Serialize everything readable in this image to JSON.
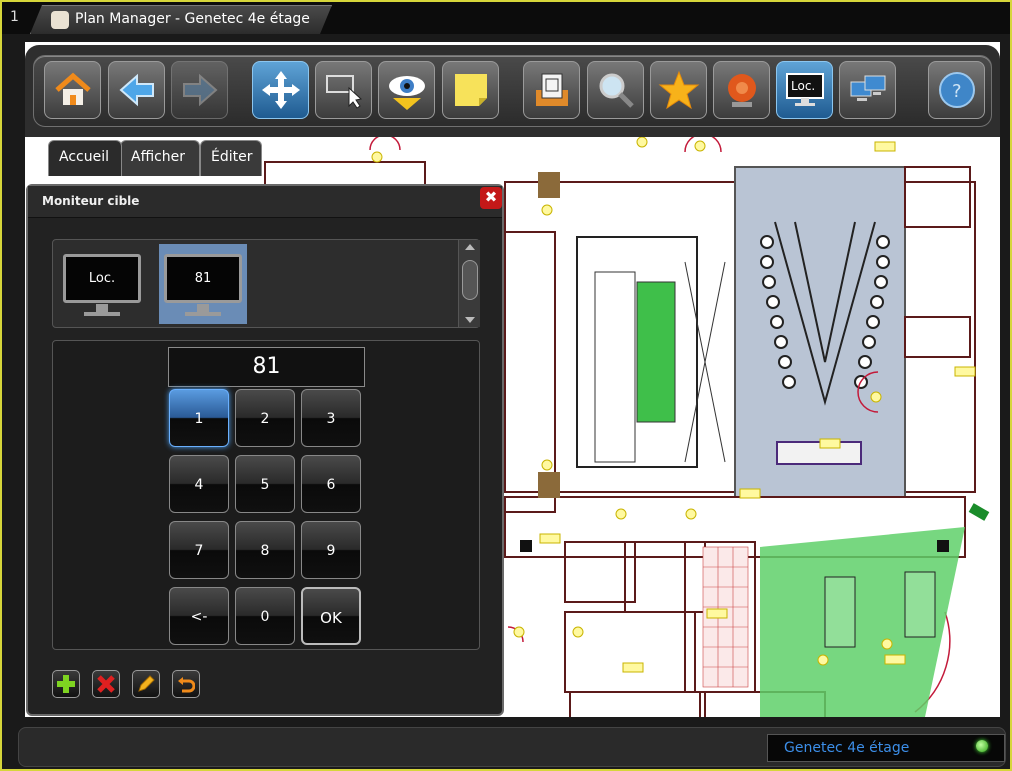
{
  "window": {
    "tab_number": "1",
    "title": "Plan Manager - Genetec 4e étage"
  },
  "toolbar": {
    "buttons": [
      {
        "icon": "home-icon"
      },
      {
        "icon": "arrow-left-icon"
      },
      {
        "icon": "arrow-right-icon"
      },
      {
        "icon": "pan-move-icon"
      },
      {
        "icon": "select-pointer-icon"
      },
      {
        "icon": "eye-icon"
      },
      {
        "icon": "note-icon"
      },
      {
        "icon": "map-tray-icon"
      },
      {
        "icon": "search-magnifier-icon"
      },
      {
        "icon": "star-favorite-icon"
      },
      {
        "icon": "alarm-bell-icon"
      },
      {
        "icon": "local-monitor-icon",
        "label": "Loc."
      },
      {
        "icon": "network-monitors-icon"
      },
      {
        "icon": "help-icon"
      }
    ]
  },
  "ribbon_tabs": [
    "Accueil",
    "Afficher",
    "Éditer"
  ],
  "dialog": {
    "title": "Moniteur cible",
    "close": "✖",
    "monitors": [
      "Loc.",
      "81"
    ],
    "display_value": "81",
    "keys": [
      "1",
      "2",
      "3",
      "4",
      "5",
      "6",
      "7",
      "8",
      "9",
      "<-",
      "0",
      "OK"
    ],
    "actions": [
      {
        "icon": "add-icon"
      },
      {
        "icon": "delete-icon"
      },
      {
        "icon": "edit-pencil-icon"
      },
      {
        "icon": "undo-icon"
      }
    ]
  },
  "status": {
    "text": "Genetec 4e étage"
  },
  "colors": {
    "accent_blue": "#2f7fc4",
    "status_text": "#3c8ee8",
    "frame_yellow": "#d6d63a",
    "camera_field_green": "#5fd06a"
  }
}
